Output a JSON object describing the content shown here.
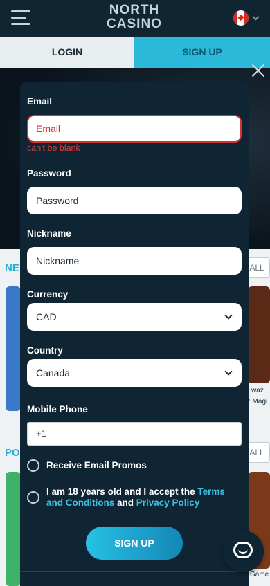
{
  "header": {
    "logo_line1": "NORTH",
    "logo_line2": "CASINO",
    "menu_icon": "hamburger-icon",
    "flag_icon": "canada-flag-icon"
  },
  "tabs": {
    "login": "LOGIN",
    "signup": "SIGN UP"
  },
  "background": {
    "new_title": "NE",
    "new_all": "ALL",
    "popular_title": "PO",
    "popular_all": "ALL",
    "card_caption_1": "waz",
    "card_caption_2": ": Magi",
    "card_caption_3": "Game"
  },
  "form": {
    "email_label": "Email",
    "email_placeholder": "Email",
    "email_error": "can't be blank",
    "password_label": "Password",
    "password_placeholder": "Password",
    "nickname_label": "Nickname",
    "nickname_placeholder": "Nickname",
    "currency_label": "Currency",
    "currency_value": "CAD",
    "country_label": "Country",
    "country_value": "Canada",
    "phone_label": "Mobile Phone",
    "phone_value": "+1",
    "promos_label": "Receive Email Promos",
    "terms_prefix": "I am 18 years old and I accept the ",
    "terms_link": "Terms and Conditions",
    "terms_and": " and ",
    "privacy_link": "Privacy Policy",
    "submit_label": "SIGN UP"
  },
  "colors": {
    "accent": "#2ab9d8",
    "error": "#d53232",
    "modal_bg": "#0f2534"
  }
}
